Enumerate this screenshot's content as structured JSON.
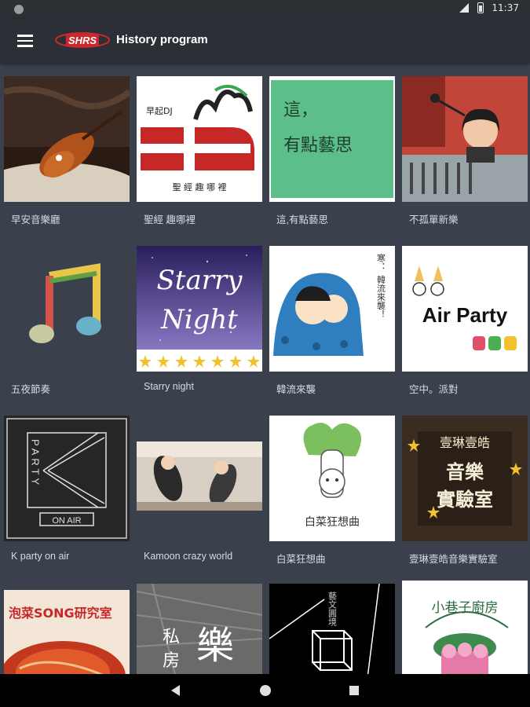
{
  "status_bar": {
    "time": "11:37"
  },
  "app_bar": {
    "logo_text": "SHRS",
    "title": "History program"
  },
  "programs": [
    {
      "label": "早安音樂廳"
    },
    {
      "label": "聖經 趣哪裡",
      "art_text": "早起DJ",
      "art_subtitle": "聖 經 趣 哪 裡"
    },
    {
      "label": "這,有點藝思",
      "art_line1": "這，",
      "art_line2": "有點藝思"
    },
    {
      "label": "不孤單新樂"
    },
    {
      "label": "五夜節奏"
    },
    {
      "label": "Starry night",
      "art_line1": "Starry",
      "art_line2": "Night"
    },
    {
      "label": "韓流來襲",
      "art_text": "寒．．韓流來襲！"
    },
    {
      "label": "空中。派對",
      "art_text": "Air Party"
    },
    {
      "label": "K party on air",
      "art_text": "PARTY",
      "art_badge": "ON AIR"
    },
    {
      "label": "Kamoon crazy world"
    },
    {
      "label": "白菜狂想曲",
      "art_text": "白菜狂想曲"
    },
    {
      "label": "壹琳壹皓音樂實驗室",
      "art_line1": "壹琳壹皓",
      "art_line2": "音樂",
      "art_line3": "實驗室"
    },
    {
      "label": "",
      "art_text": "泡菜SONG研究室"
    },
    {
      "label": "",
      "art_line1": "私",
      "art_line2": "房",
      "art_line3": "樂"
    },
    {
      "label": "",
      "art_text": "藝文圓境"
    },
    {
      "label": "",
      "art_text": "小巷子廚房"
    }
  ],
  "colors": {
    "app_bar": "#2c3036",
    "background": "#3a414d",
    "status_bar": "#2c2f34"
  }
}
